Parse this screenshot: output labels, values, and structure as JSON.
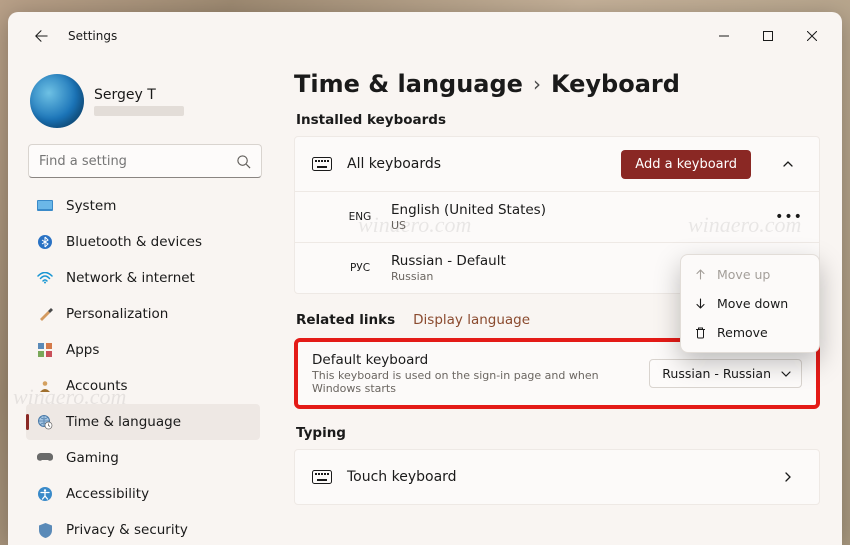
{
  "window": {
    "title": "Settings"
  },
  "profile": {
    "name": "Sergey T"
  },
  "search": {
    "placeholder": "Find a setting"
  },
  "sidebar": {
    "items": [
      {
        "label": "System"
      },
      {
        "label": "Bluetooth & devices"
      },
      {
        "label": "Network & internet"
      },
      {
        "label": "Personalization"
      },
      {
        "label": "Apps"
      },
      {
        "label": "Accounts"
      },
      {
        "label": "Time & language"
      },
      {
        "label": "Gaming"
      },
      {
        "label": "Accessibility"
      },
      {
        "label": "Privacy & security"
      }
    ]
  },
  "breadcrumb": {
    "parent": "Time & language",
    "sep": "›",
    "current": "Keyboard"
  },
  "sections": {
    "installed": "Installed keyboards",
    "related_links": "Related links",
    "typing": "Typing"
  },
  "installed": {
    "all": "All keyboards",
    "add_btn": "Add a keyboard",
    "entries": [
      {
        "tag": "ENG",
        "name": "English (United States)",
        "sub": "US"
      },
      {
        "tag": "РУС",
        "name": "Russian  - Default",
        "sub": "Russian"
      }
    ]
  },
  "related": {
    "link": "Display language"
  },
  "default_kb": {
    "title": "Default keyboard",
    "subtitle": "This keyboard is used on the sign-in page and when Windows starts",
    "value": "Russian - Russian"
  },
  "touch": {
    "label": "Touch keyboard"
  },
  "context_menu": {
    "move_up": "Move up",
    "move_down": "Move down",
    "remove": "Remove"
  },
  "watermark": "winaero.com"
}
